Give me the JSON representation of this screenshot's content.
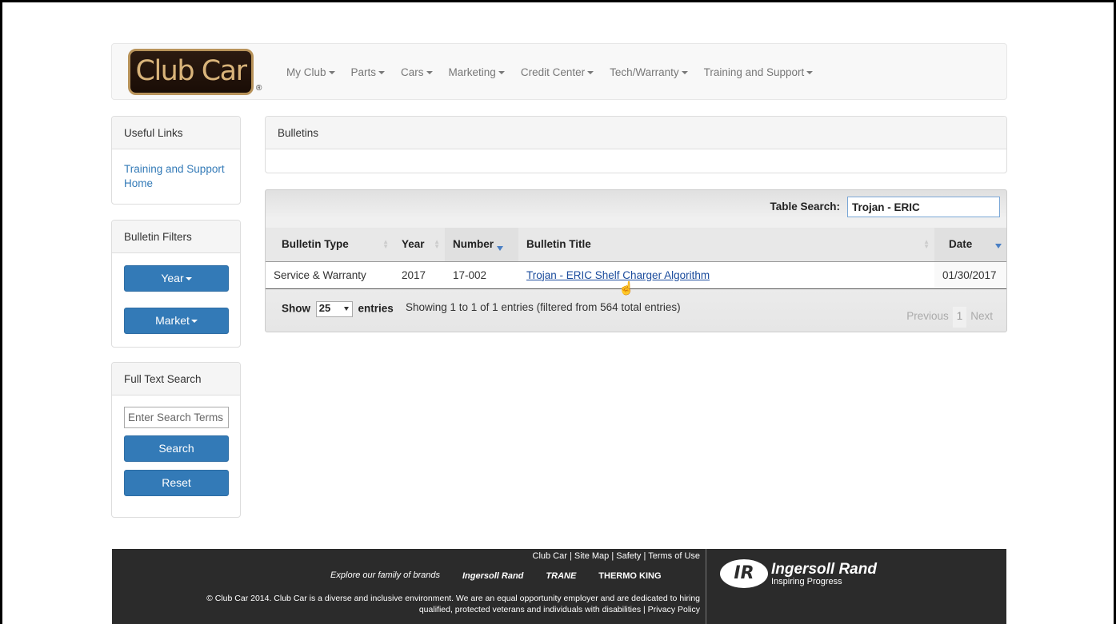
{
  "nav": {
    "logo": "Club Car",
    "logo_reg": "®",
    "items": [
      {
        "label": "My Club"
      },
      {
        "label": "Parts"
      },
      {
        "label": "Cars"
      },
      {
        "label": "Marketing"
      },
      {
        "label": "Credit Center"
      },
      {
        "label": "Tech/Warranty"
      },
      {
        "label": "Training and Support"
      }
    ]
  },
  "sidebar": {
    "useful_links": {
      "title": "Useful Links",
      "link": "Training and Support Home"
    },
    "filters": {
      "title": "Bulletin Filters",
      "year_label": "Year",
      "market_label": "Market"
    },
    "fulltext": {
      "title": "Full Text Search",
      "placeholder": "Enter Search Terms",
      "search_label": "Search",
      "reset_label": "Reset"
    }
  },
  "main": {
    "title": "Bulletins",
    "table_search_label": "Table Search:",
    "table_search_value": "Trojan - ERIC",
    "columns": [
      "Bulletin Type",
      "Year",
      "Number",
      "Bulletin Title",
      "Date"
    ],
    "rows": [
      {
        "type": "Service & Warranty",
        "year": "2017",
        "number": "17-002",
        "title": "Trojan - ERIC Shelf Charger Algorithm",
        "date": "01/30/2017"
      }
    ],
    "show_label": "Show",
    "page_length": "25",
    "entries_label": "entries",
    "info": "Showing 1 to 1 of 1 entries (filtered from 564 total entries)",
    "pager": {
      "previous": "Previous",
      "page": "1",
      "next": "Next"
    }
  },
  "footer": {
    "links": "Club Car  |  Site Map  |  Safety  |  Terms of Use",
    "explore": "Explore our family of brands",
    "brands": [
      "Ingersoll Rand",
      "TRANE",
      "THERMO KING"
    ],
    "copy_line1": "© Club Car 2014. Club Car is a diverse and inclusive environment. We are an equal opportunity employer and are dedicated to hiring",
    "copy_line2": "qualified, protected veterans and individuals with disabilities |  Privacy Policy",
    "ir_mark": "IR",
    "ir_name": "Ingersoll Rand",
    "ir_tagline": "Inspiring Progress"
  }
}
